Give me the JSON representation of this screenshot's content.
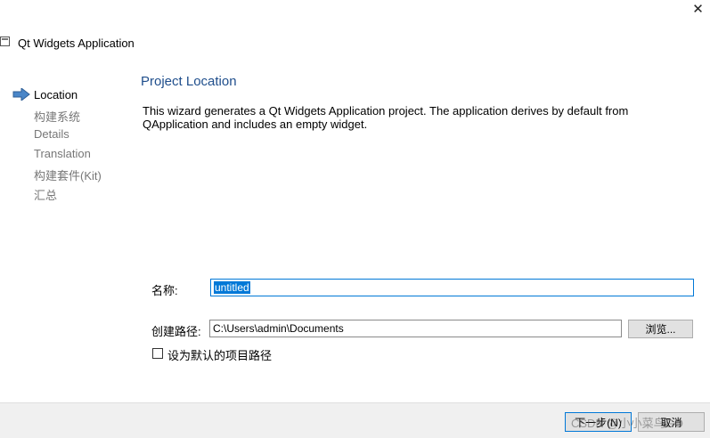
{
  "window": {
    "title": "Qt Widgets Application",
    "close_glyph": "✕"
  },
  "steps": [
    {
      "label": "Location",
      "active": true
    },
    {
      "label": "构建系统",
      "active": false
    },
    {
      "label": "Details",
      "active": false
    },
    {
      "label": "Translation",
      "active": false
    },
    {
      "label": "构建套件(Kit)",
      "active": false
    },
    {
      "label": "汇总",
      "active": false
    }
  ],
  "page": {
    "title": "Project Location",
    "description": "This wizard generates a Qt Widgets Application project. The application derives by default from QApplication and includes an empty widget."
  },
  "form": {
    "name_label": "名称:",
    "name_value": "untitled",
    "path_label": "创建路径:",
    "path_value": "C:\\Users\\admin\\Documents",
    "browse_label": "浏览...",
    "default_path_label": "设为默认的项目路径"
  },
  "footer": {
    "next_label": "下一步(N)",
    "cancel_label": "取消",
    "watermark": "CSDN @小小菜鸟GO"
  },
  "colors": {
    "accent": "#0078d7",
    "title_blue": "#1f4e8c",
    "arrow_blue": "#4a86c8"
  }
}
